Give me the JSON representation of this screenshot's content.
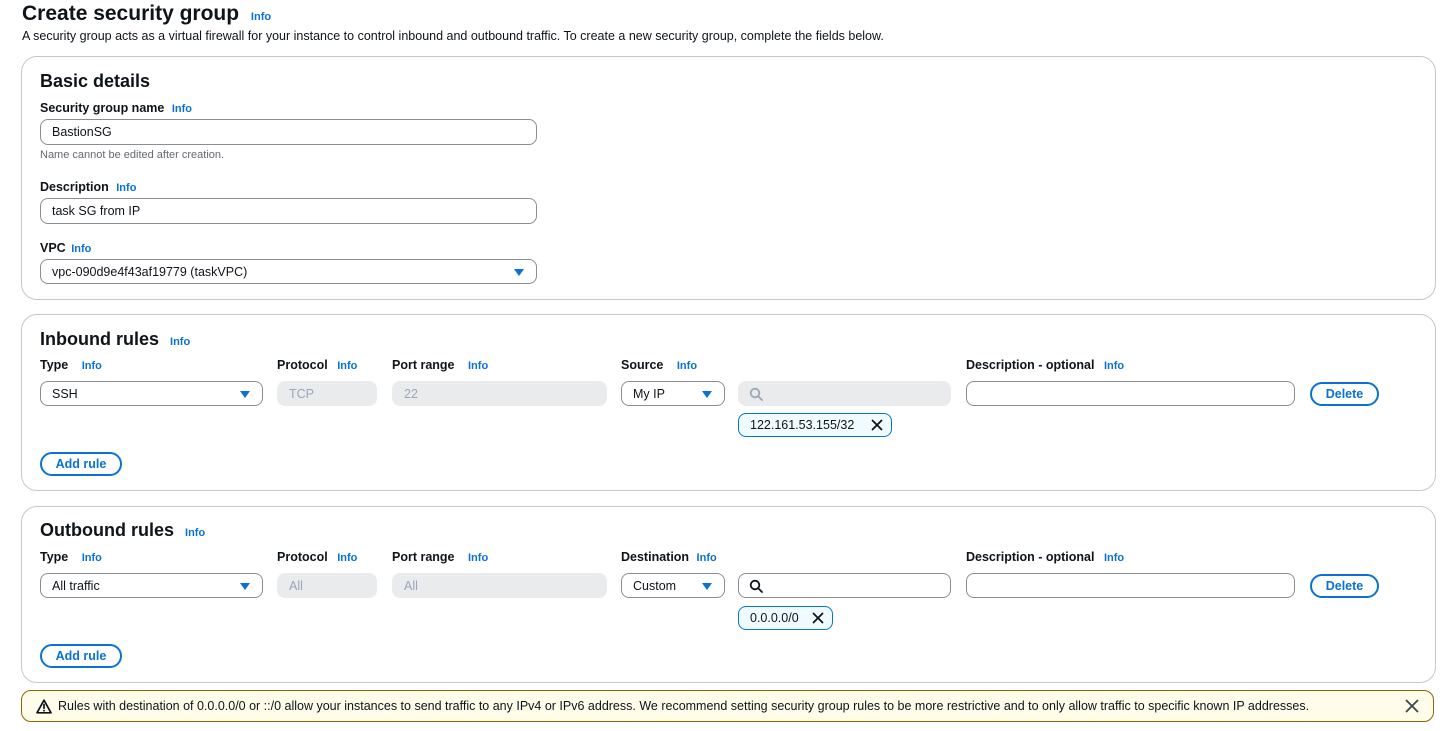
{
  "page": {
    "title": "Create security group",
    "info": "Info",
    "description": "A security group acts as a virtual firewall for your instance to control inbound and outbound traffic. To create a new security group, complete the fields below."
  },
  "basic": {
    "title": "Basic details",
    "name_label": "Security group name",
    "name_value": "BastionSG",
    "name_hint": "Name cannot be edited after creation.",
    "desc_label": "Description",
    "desc_value": "task SG from IP",
    "vpc_label": "VPC",
    "vpc_value": "vpc-090d9e4f43af19779 (taskVPC)"
  },
  "inbound": {
    "title": "Inbound rules",
    "col_type": "Type",
    "col_protocol": "Protocol",
    "col_port": "Port range",
    "col_source": "Source",
    "col_desc": "Description - optional",
    "type_value": "SSH",
    "protocol_value": "TCP",
    "port_value": "22",
    "source_value": "My IP",
    "search_value": "",
    "token": "122.161.53.155/32",
    "desc_value": "",
    "delete": "Delete",
    "add_rule": "Add rule"
  },
  "outbound": {
    "title": "Outbound rules",
    "col_type": "Type",
    "col_protocol": "Protocol",
    "col_port": "Port range",
    "col_dest": "Destination",
    "col_desc": "Description - optional",
    "type_value": "All traffic",
    "protocol_value": "All",
    "port_value": "All",
    "dest_value": "Custom",
    "search_value": "",
    "token": "0.0.0.0/0",
    "desc_value": "",
    "delete": "Delete",
    "add_rule": "Add rule"
  },
  "alert": {
    "message": "Rules with destination of 0.0.0.0/0 or ::/0 allow your instances to send traffic to any IPv4 or IPv6 address. We recommend setting security group rules to be more restrictive and to only allow traffic to specific known IP addresses."
  },
  "colors": {
    "link": "#0972d3",
    "warning_border": "#8d6605",
    "warning_bg": "#fffce9"
  },
  "icons": [
    "info-link",
    "caret-down-icon",
    "search-icon",
    "close-icon",
    "warning-icon"
  ]
}
